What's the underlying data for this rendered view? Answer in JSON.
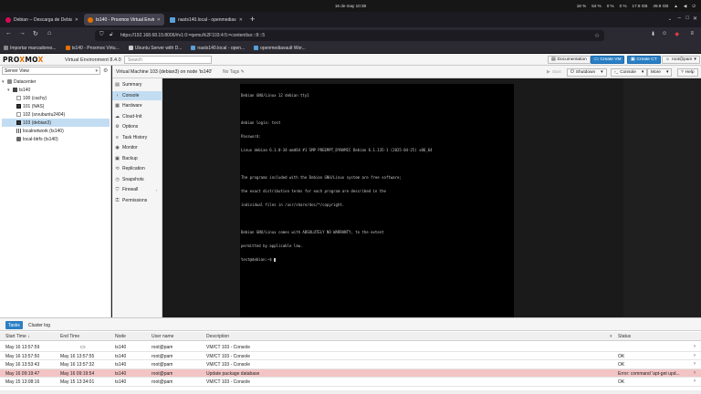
{
  "os": {
    "clock": "16 de may 10:38",
    "tray": [
      "18 %",
      "54 %",
      "0 %",
      "0 %",
      "17.9 GB",
      "49.9 GB"
    ]
  },
  "browser": {
    "tabs": [
      {
        "label": "Debian -- Descarga de Debian",
        "active": false,
        "color": "#d70a53"
      },
      {
        "label": "ts140 - Proxmox Virtual Environment",
        "active": true,
        "color": "#e57000"
      },
      {
        "label": "nasts140.local - openmediavault",
        "active": false,
        "color": "#5aa0d8"
      }
    ],
    "url": "https://192.168.68.15:8006/#v1:0:=qemu%2F103:4:5:=contentIso:::8:::5",
    "bookmarks": [
      "Importar marcadores...",
      "ts140 - Proxmox Virtu...",
      "Ubuntu Server with D...",
      "nasts140.local - open...",
      "openmediavault Wor..."
    ]
  },
  "pve": {
    "logo_a": "PRO",
    "logo_x": "X",
    "logo_b": "MO",
    "logo_c": "X",
    "version": "Virtual Environment 8.4.0",
    "search_placeholder": "Search",
    "header_buttons": {
      "docs": "Documentation",
      "create_vm": "Create VM",
      "create_ct": "Create CT",
      "user": "root@pam"
    }
  },
  "tree": {
    "view": "Server View",
    "nodes": [
      {
        "label": "Datacenter",
        "indent": 0
      },
      {
        "label": "ts140",
        "indent": 1
      },
      {
        "label": "100 (cachy)",
        "indent": 2
      },
      {
        "label": "101 (NAS)",
        "indent": 2
      },
      {
        "label": "102 (srvubuntu2404)",
        "indent": 2
      },
      {
        "label": "103 (debian3)",
        "indent": 2
      },
      {
        "label": "localnetwork (ts140)",
        "indent": 2
      },
      {
        "label": "local-btrfs (ts140)",
        "indent": 2
      }
    ]
  },
  "toolbar": {
    "title": "Virtual Machine 103 (debian3) on node 'ts140'",
    "tags": "No Tags",
    "start": "Start",
    "shutdown": "Shutdown",
    "console": "Console",
    "more": "More",
    "help": "Help"
  },
  "menu": [
    {
      "label": "Summary",
      "icon": "summary-icon"
    },
    {
      "label": "Console",
      "icon": "console-icon"
    },
    {
      "label": "Hardware",
      "icon": "hardware-icon"
    },
    {
      "label": "Cloud-Init",
      "icon": "cloud-icon"
    },
    {
      "label": "Options",
      "icon": "gear-icon"
    },
    {
      "label": "Task History",
      "icon": "list-icon"
    },
    {
      "label": "Monitor",
      "icon": "eye-icon"
    },
    {
      "label": "Backup",
      "icon": "floppy-icon"
    },
    {
      "label": "Replication",
      "icon": "retweet-icon"
    },
    {
      "label": "Snapshots",
      "icon": "history-icon"
    },
    {
      "label": "Firewall",
      "icon": "shield-icon"
    },
    {
      "label": "Permissions",
      "icon": "unlock-icon"
    }
  ],
  "console_lines": [
    "Debian GNU/Linux 12 debian tty1",
    "",
    "debian login: test",
    "Password:",
    "Linux debian 6.1.0-34-amd64 #1 SMP PREEMPT_DYNAMIC Debian 6.1.135-1 (2025-04-25) x86_64",
    "",
    "The programs included with the Debian GNU/Linux system are free software;",
    "the exact distribution terms for each program are described in the",
    "individual files in /usr/share/doc/*/copyright.",
    "",
    "Debian GNU/Linux comes with ABSOLUTELY NO WARRANTY, to the extent",
    "permitted by applicable law.",
    "test@debian:~$ "
  ],
  "tasks": {
    "tabs": [
      "Tasks",
      "Cluster log"
    ],
    "columns": [
      "Start Time",
      "End Time",
      "Node",
      "User name",
      "Description",
      "Status"
    ],
    "rows": [
      {
        "start": "May 16 13:57:59",
        "end": "",
        "node": "ts140",
        "user": "root@pam",
        "desc": "VM/CT 103 - Console",
        "status": "",
        "error": false,
        "running": true
      },
      {
        "start": "May 16 13:57:50",
        "end": "May 16 13:57:55",
        "node": "ts140",
        "user": "root@pam",
        "desc": "VM/CT 103 - Console",
        "status": "OK",
        "error": false,
        "running": false
      },
      {
        "start": "May 16 13:53:43",
        "end": "May 16 13:57:32",
        "node": "ts140",
        "user": "root@pam",
        "desc": "VM/CT 103 - Console",
        "status": "OK",
        "error": false,
        "running": false
      },
      {
        "start": "May 16 09:19:47",
        "end": "May 16 09:19:54",
        "node": "ts140",
        "user": "root@pam",
        "desc": "Update package database",
        "status": "Error: command 'apt-get upd...",
        "error": true,
        "running": false
      },
      {
        "start": "May 15 13:08:16",
        "end": "May 15 13:34:01",
        "node": "ts140",
        "user": "root@pam",
        "desc": "VM/CT 103 - Console",
        "status": "OK",
        "error": false,
        "running": false
      }
    ]
  }
}
